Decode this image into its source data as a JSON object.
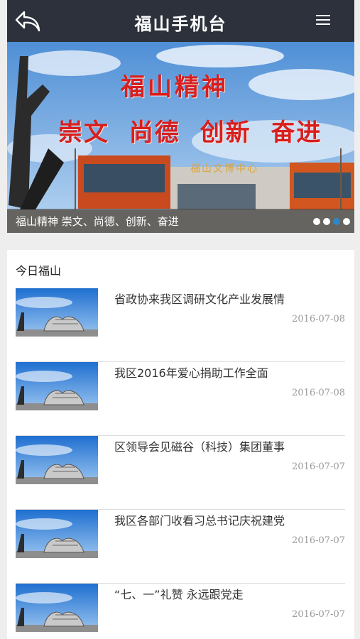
{
  "header": {
    "title": "福山手机台",
    "back_icon": "back-arrow-icon",
    "menu_icon": "hamburger-menu-icon",
    "background_color": "#2d313b"
  },
  "banner": {
    "slogan_line1": "福山精神",
    "slogan_line2": "崇文 尚德 创新 奋进",
    "building_sign": "福山文博中心",
    "caption": "福山精神 崇文、尚德、创新、奋进",
    "slide_count": 4,
    "active_slide": 3,
    "active_dot_color": "#2e86c9"
  },
  "news_section": {
    "title": "今日福山",
    "items": [
      {
        "title": "省政协来我区调研文化产业发展情",
        "date": "2016-07-08"
      },
      {
        "title": "我区2016年爱心捐助工作全面",
        "date": "2016-07-08"
      },
      {
        "title": "区领导会见磁谷（科技）集团董事",
        "date": "2016-07-07"
      },
      {
        "title": "我区各部门收看习总书记庆祝建党",
        "date": "2016-07-07"
      },
      {
        "title": "“七、一”礼赞 永远跟党走",
        "date": "2016-07-07"
      }
    ]
  }
}
